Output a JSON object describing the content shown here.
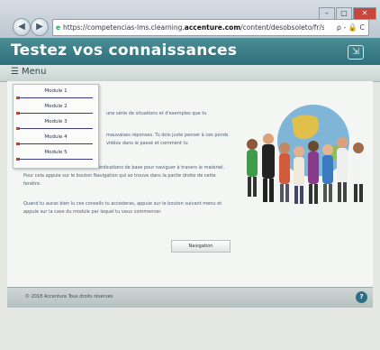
{
  "browser": {
    "url_prefix": "https://competencias-lms.clearning.",
    "url_domain": "accenture.com",
    "url_suffix": "/content/desobsoleto/fr/sim_accessi",
    "url_tools": "ρ - 🔒 C",
    "window_buttons": [
      "–",
      "▢",
      "✕"
    ]
  },
  "app": {
    "title": "Testez vos connaissances",
    "menu_label": "Menu"
  },
  "modules": [
    {
      "label": "Module 1"
    },
    {
      "label": "Module 2"
    },
    {
      "label": "Module 3"
    },
    {
      "label": "Module 4"
    },
    {
      "label": "Module 5"
    }
  ],
  "content": {
    "p1": "une série de situations et d'exemples que tu",
    "p2": "mauvaises réponses. Tu dois juste penser à ces ponds vidéos dans le passé et comment tu",
    "p3": "de recommande de consulter les indications de base pour naviguer à travers le matériel. Pour cela appuie sur le bouton Navigation qui se trouve dans la partie droite de cette fenêtre.",
    "p4": "Quand tu auras bien lu ces conseils tu accéderas, appuie sur le bouton suivant menu et appuie sur la case du module par lequel tu veux commencer.",
    "continue_label": "Navigation"
  },
  "footer": {
    "text": "© 2018 Accenture Tous droits réservés"
  },
  "colors": {
    "header": "#2e6f79",
    "menu_underline": "#3a3a8a",
    "menu_marker": "#b4472d"
  }
}
